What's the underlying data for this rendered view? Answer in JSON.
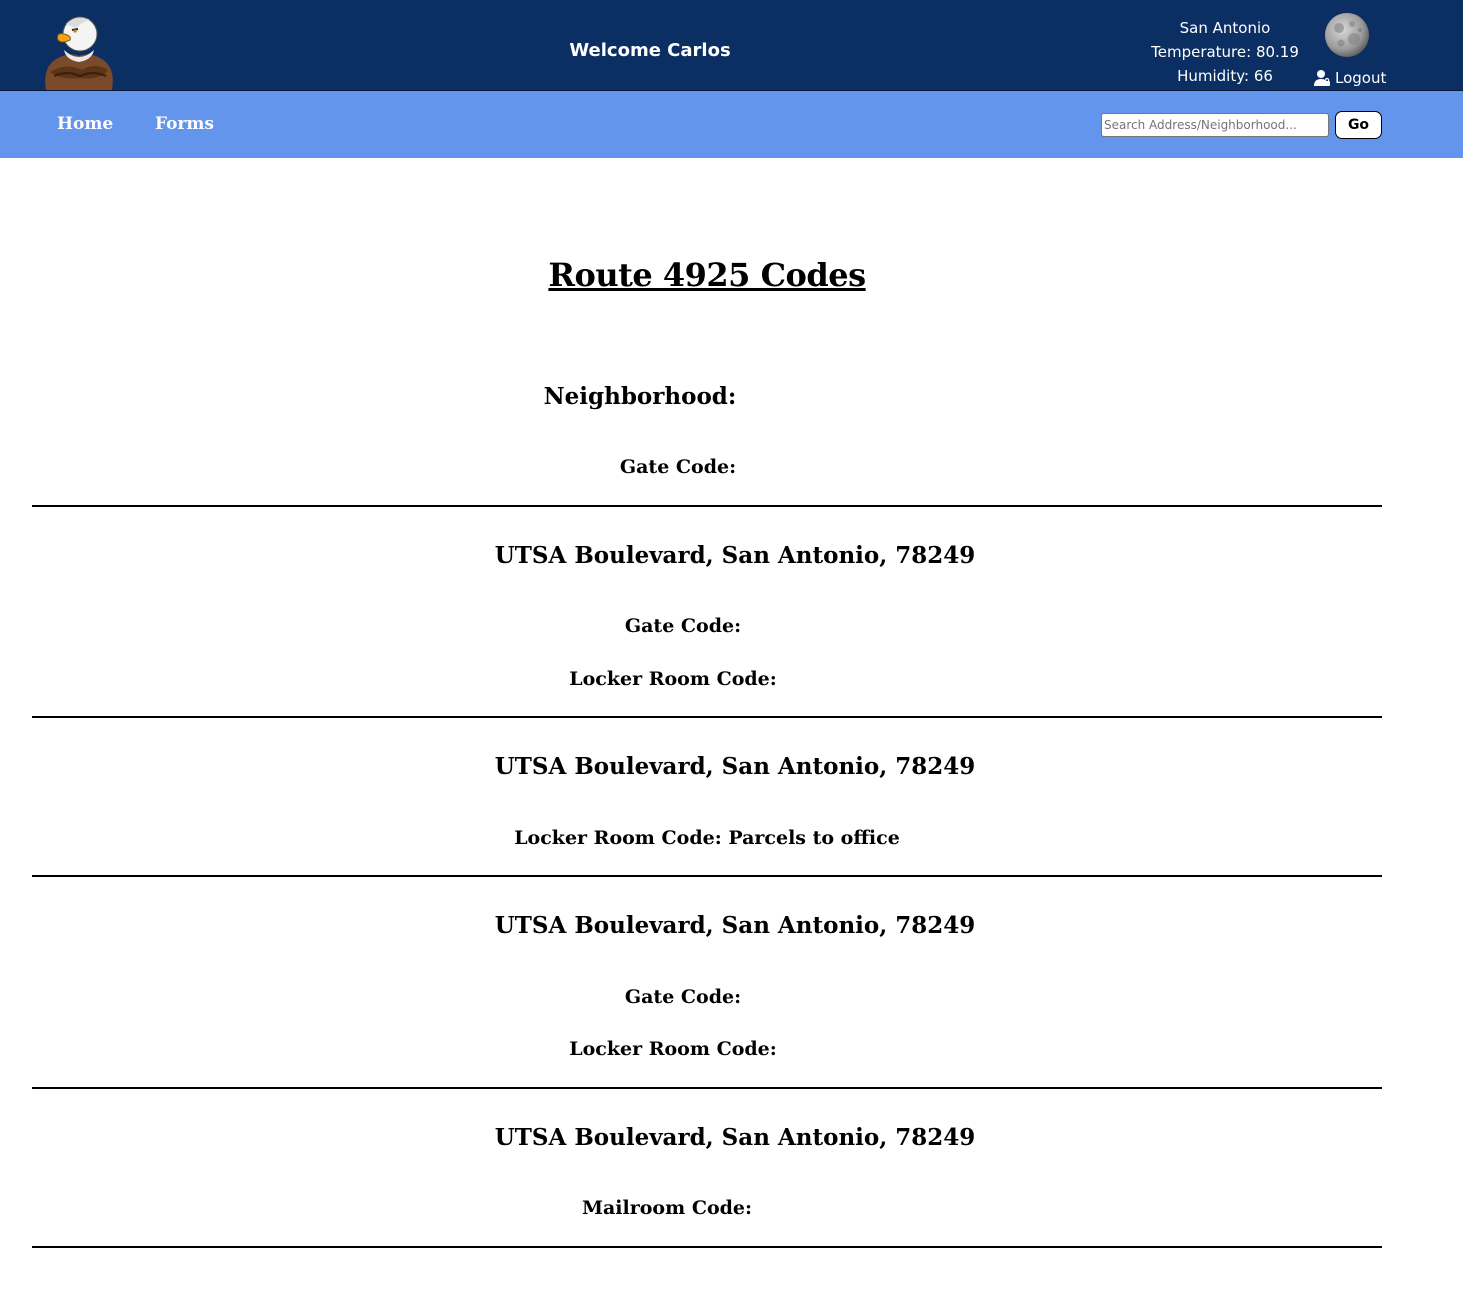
{
  "header": {
    "logo_icon": "eagle-mascot-logo",
    "welcome_text": "Welcome Carlos",
    "weather": {
      "city": "San Antonio",
      "temperature_text": "Temperature: 80.19",
      "humidity_text": "Humidity: 66",
      "icon": "moon-icon"
    },
    "logout_label": "Logout",
    "logout_icon": "user-lock-icon"
  },
  "nav": {
    "items": [
      {
        "label": "Home"
      },
      {
        "label": "Forms"
      }
    ],
    "search": {
      "placeholder": "Search Address/Neighborhood...",
      "value": "",
      "button_label": "Go"
    }
  },
  "main": {
    "title": "Route 4925 Codes",
    "sections": [
      {
        "heading": "Neighborhood:",
        "lines": [
          "Gate Code:"
        ]
      },
      {
        "heading": "UTSA Boulevard, San Antonio, 78249",
        "lines": [
          "Gate Code:",
          "Locker Room Code:"
        ]
      },
      {
        "heading": "UTSA Boulevard, San Antonio, 78249",
        "lines": [
          "Locker Room Code: Parcels to office"
        ]
      },
      {
        "heading": "UTSA Boulevard, San Antonio, 78249",
        "lines": [
          "Gate Code:",
          "Locker Room Code:"
        ]
      },
      {
        "heading": "UTSA Boulevard, San Antonio, 78249",
        "lines": [
          "Mailroom Code:"
        ]
      }
    ]
  },
  "colors": {
    "header_bg": "#0c2f63",
    "nav_bg": "#6495ed",
    "text": "#000000"
  }
}
